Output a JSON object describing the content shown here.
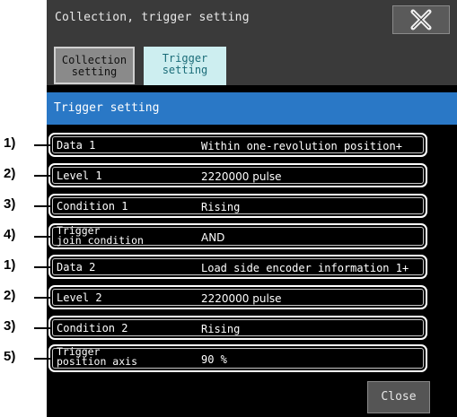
{
  "window": {
    "title": "Collection, trigger setting"
  },
  "tabs": [
    {
      "label_line1": "Collection",
      "label_line2": "setting",
      "active": false
    },
    {
      "label_line1": "Trigger",
      "label_line2": "setting",
      "active": true
    }
  ],
  "section": {
    "title": "Trigger setting"
  },
  "rows": [
    {
      "callout": "1)",
      "label": "Data 1",
      "value": "Within one-revolution position+"
    },
    {
      "callout": "2)",
      "label": "Level 1",
      "value": "2220000 pulse"
    },
    {
      "callout": "3)",
      "label": "Condition 1",
      "value": "Rising"
    },
    {
      "callout": "4)",
      "label_line1": "Trigger",
      "label_line2": "join condition",
      "value": "AND"
    },
    {
      "callout": "1)",
      "label": "Data 2",
      "value": "Load side encoder information 1+"
    },
    {
      "callout": "2)",
      "label": "Level 2",
      "value": "2220000 pulse"
    },
    {
      "callout": "3)",
      "label": "Condition 2",
      "value": "Rising"
    },
    {
      "callout": "5)",
      "label_line1": "Trigger",
      "label_line2": "position axis",
      "value": "90 %"
    }
  ],
  "footer": {
    "close_label": "Close"
  },
  "icons": {
    "close": "close-x-icon"
  }
}
